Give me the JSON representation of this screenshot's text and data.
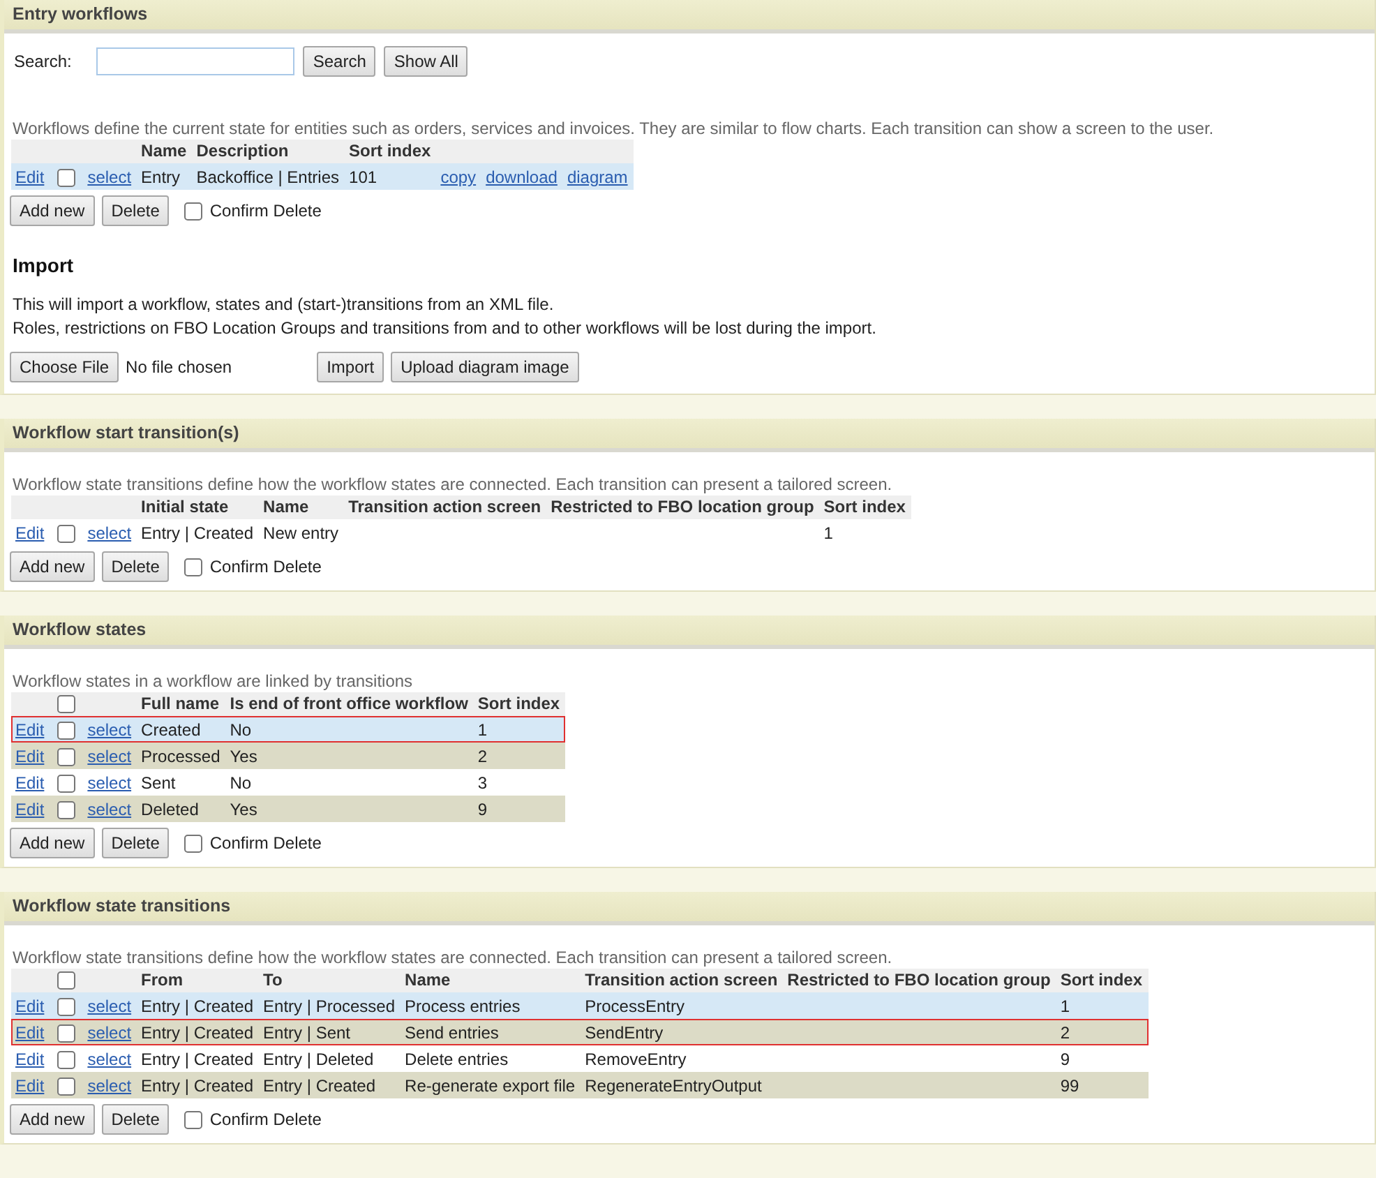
{
  "sections": [
    {
      "title": "Entry workflows",
      "search": {
        "label": "Search:",
        "button": "Search",
        "show_all": "Show All"
      },
      "description": "Workflows define the current state for entities such as orders, services and invoices. They are similar to flow charts. Each transition can show a screen to the user.",
      "table": {
        "columns": [
          "Name",
          "Description",
          "Sort index"
        ],
        "rows": [
          {
            "edit": "Edit",
            "select": "select",
            "checked": false,
            "hovered": true,
            "selected": false,
            "cells": [
              "Entry",
              "Backoffice | Entries",
              "101"
            ],
            "links": [
              "copy",
              "download",
              "diagram"
            ]
          }
        ]
      },
      "actions": {
        "add": "Add new",
        "delete": "Delete",
        "confirm": {
          "label": "Confirm Delete",
          "checked": false
        }
      },
      "import": {
        "title": "Import",
        "lines": [
          "This will import a workflow, states and (start-)transitions from an XML file.",
          "Roles, restrictions on FBO Location Groups and transitions from and to other workflows will be lost during the import."
        ],
        "choose": "Choose File",
        "no_file": "No file chosen",
        "import_button": "Import",
        "upload_button": "Upload diagram image"
      }
    },
    {
      "title": "Workflow start transition(s)",
      "description": "Workflow state transitions define how the workflow states are connected. Each transition can present a tailored screen.",
      "table": {
        "columns": [
          "Initial state",
          "Name",
          "Transition action screen",
          "Restricted to FBO location group",
          "Sort index"
        ],
        "rows": [
          {
            "edit": "Edit",
            "select": "select",
            "checked": false,
            "hovered": false,
            "selected": false,
            "cells": [
              "Entry | Created",
              "New entry",
              "",
              "",
              "1"
            ]
          }
        ]
      },
      "actions": {
        "add": "Add new",
        "delete": "Delete",
        "confirm": {
          "label": "Confirm Delete",
          "checked": false
        }
      }
    },
    {
      "title": "Workflow states",
      "description": "Workflow states in a workflow are linked by transitions",
      "table": {
        "header_checkbox": {
          "checked": false
        },
        "columns": [
          "Full name",
          "Is end of front office workflow",
          "Sort index"
        ],
        "rows": [
          {
            "edit": "Edit",
            "select": "select",
            "checked": false,
            "hovered": true,
            "selected": true,
            "cells": [
              "Created",
              "No",
              "1"
            ]
          },
          {
            "edit": "Edit",
            "select": "select",
            "checked": false,
            "hovered": false,
            "selected": false,
            "cells": [
              "Processed",
              "Yes",
              "2"
            ]
          },
          {
            "edit": "Edit",
            "select": "select",
            "checked": false,
            "hovered": false,
            "selected": false,
            "cells": [
              "Sent",
              "No",
              "3"
            ]
          },
          {
            "edit": "Edit",
            "select": "select",
            "checked": false,
            "hovered": false,
            "selected": false,
            "cells": [
              "Deleted",
              "Yes",
              "9"
            ]
          }
        ]
      },
      "actions": {
        "add": "Add new",
        "delete": "Delete",
        "confirm": {
          "label": "Confirm Delete",
          "checked": false
        }
      }
    },
    {
      "title": "Workflow state transitions",
      "description": "Workflow state transitions define how the workflow states are connected. Each transition can present a tailored screen.",
      "table": {
        "header_checkbox": {
          "checked": false
        },
        "columns": [
          "From",
          "To",
          "Name",
          "Transition action screen",
          "Restricted to FBO location group",
          "Sort index"
        ],
        "rows": [
          {
            "edit": "Edit",
            "select": "select",
            "checked": false,
            "hovered": true,
            "selected": false,
            "cells": [
              "Entry | Created",
              "Entry | Processed",
              "Process entries",
              "ProcessEntry",
              "",
              "1"
            ]
          },
          {
            "edit": "Edit",
            "select": "select",
            "checked": false,
            "hovered": false,
            "selected": true,
            "cells": [
              "Entry | Created",
              "Entry | Sent",
              "Send entries",
              "SendEntry",
              "",
              "2"
            ]
          },
          {
            "edit": "Edit",
            "select": "select",
            "checked": false,
            "hovered": false,
            "selected": false,
            "cells": [
              "Entry | Created",
              "Entry | Deleted",
              "Delete entries",
              "RemoveEntry",
              "",
              "9"
            ]
          },
          {
            "edit": "Edit",
            "select": "select",
            "checked": false,
            "hovered": false,
            "selected": false,
            "cells": [
              "Entry | Created",
              "Entry | Created",
              "Re-generate export file",
              "RegenerateEntryOutput",
              "",
              "99"
            ]
          }
        ]
      },
      "actions": {
        "add": "Add new",
        "delete": "Delete",
        "confirm": {
          "label": "Confirm Delete",
          "checked": false
        }
      }
    }
  ]
}
